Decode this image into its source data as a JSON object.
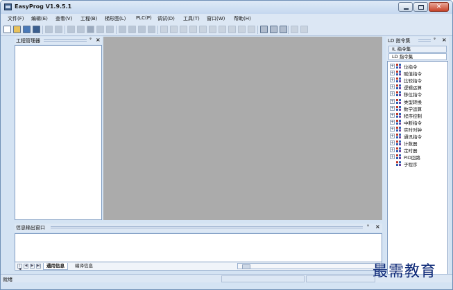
{
  "window": {
    "title": "EasyProg V1.9.5.1"
  },
  "menu": [
    "文件(F)",
    "编辑(E)",
    "查看(V)",
    "工程(B)",
    "梯形图(L)",
    "PLC(P)",
    "调试(D)",
    "工具(T)",
    "窗口(W)",
    "帮助(H)"
  ],
  "toolbar_icons": [
    {
      "name": "new-file-icon",
      "color": "#ffffff",
      "enabled": true
    },
    {
      "name": "open-folder-icon",
      "color": "#e8c15a",
      "enabled": true
    },
    {
      "name": "save-icon",
      "color": "#4a79b8",
      "enabled": true
    },
    {
      "name": "save-all-icon",
      "color": "#3c5f8f",
      "enabled": true
    },
    {
      "name": "print-preview-icon",
      "color": "#b9c6d6",
      "enabled": false
    },
    {
      "name": "print-icon",
      "color": "#b9c6d6",
      "enabled": false
    },
    {
      "name": "cut-icon",
      "color": "#b9c6d6",
      "enabled": false
    },
    {
      "name": "copy-icon",
      "color": "#b9c6d6",
      "enabled": false
    },
    {
      "name": "paste-icon",
      "color": "#9aa9bd",
      "enabled": false
    },
    {
      "name": "undo-icon",
      "color": "#b9c6d6",
      "enabled": false
    },
    {
      "name": "redo-icon",
      "color": "#b9c6d6",
      "enabled": false
    },
    {
      "name": "insert-row-icon",
      "color": "#b9c6d6",
      "enabled": false
    },
    {
      "name": "delete-row-icon",
      "color": "#b9c6d6",
      "enabled": false
    },
    {
      "name": "compile-icon",
      "color": "#b9c6d6",
      "enabled": false
    },
    {
      "name": "monitor-icon",
      "color": "#b9c6d6",
      "enabled": false
    },
    {
      "name": "contact-no-icon",
      "color": "#c9d3df",
      "enabled": false
    },
    {
      "name": "contact-nc-icon",
      "color": "#c9d3df",
      "enabled": false
    },
    {
      "name": "contact-parallel-icon",
      "color": "#c9d3df",
      "enabled": false
    },
    {
      "name": "contact-parallel-nc-icon",
      "color": "#c9d3df",
      "enabled": false
    },
    {
      "name": "rising-edge-icon",
      "color": "#c9d3df",
      "enabled": false
    },
    {
      "name": "falling-edge-icon",
      "color": "#c9d3df",
      "enabled": false
    },
    {
      "name": "coil-icon",
      "color": "#c9d3df",
      "enabled": false
    },
    {
      "name": "function-box-icon",
      "color": "#c9d3df",
      "enabled": false
    },
    {
      "name": "delete-icon",
      "color": "#c9d3df",
      "enabled": false
    },
    {
      "name": "horizontal-line-icon",
      "color": "#c9d3df",
      "enabled": false
    },
    {
      "name": "vertical-line-icon",
      "color": "#b0bccd",
      "enabled": true
    },
    {
      "name": "comment-icon",
      "color": "#b0bccd",
      "enabled": true
    },
    {
      "name": "download-icon",
      "color": "#b0bccd",
      "enabled": true
    },
    {
      "name": "upload-icon",
      "color": "#c9d3df",
      "enabled": false
    },
    {
      "name": "run-icon",
      "color": "#c9d3df",
      "enabled": false
    }
  ],
  "project_panel": {
    "title": "工程管理器",
    "pin": "ᵠ",
    "close": "×"
  },
  "ld_panel": {
    "title": "LD 指令集",
    "pin": "ᵠ",
    "close": "×",
    "tabs": [
      "IL 指令集",
      "LD 指令集"
    ],
    "items": [
      {
        "label": "位指令",
        "expandable": true
      },
      {
        "label": "赋值指令",
        "expandable": true
      },
      {
        "label": "比较指令",
        "expandable": true
      },
      {
        "label": "逻辑运算",
        "expandable": true
      },
      {
        "label": "移位指令",
        "expandable": true
      },
      {
        "label": "类型转换",
        "expandable": true
      },
      {
        "label": "数学运算",
        "expandable": true
      },
      {
        "label": "程序控制",
        "expandable": true
      },
      {
        "label": "中断指令",
        "expandable": true
      },
      {
        "label": "实时时钟",
        "expandable": true
      },
      {
        "label": "通讯指令",
        "expandable": true
      },
      {
        "label": "计数器",
        "expandable": true
      },
      {
        "label": "定时器",
        "expandable": true
      },
      {
        "label": "PID回路",
        "expandable": true
      },
      {
        "label": "子程序",
        "expandable": false
      }
    ],
    "expand_glyph": "+"
  },
  "output_panel": {
    "title": "信息输出窗口",
    "pin": "ᵠ",
    "close": "×",
    "nav": [
      "|◀",
      "◀",
      "▶",
      "▶|"
    ],
    "tabs": [
      "通用信息",
      "编译信息"
    ],
    "active_tab": "通用信息"
  },
  "status": {
    "text": "就绪"
  },
  "watermark": "最需教育",
  "colors": {
    "editor_bg": "#ababab",
    "chrome": "#dce7f4",
    "panel_border": "#7f9cc2"
  }
}
